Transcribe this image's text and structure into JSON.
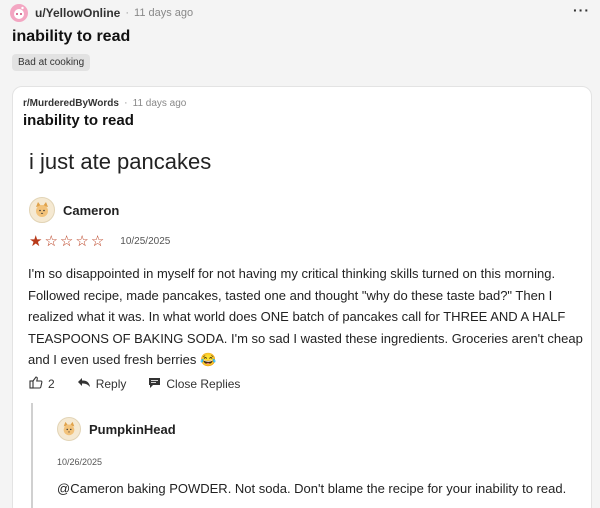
{
  "post": {
    "username": "u/YellowOnline",
    "separator": "·",
    "time": "11 days ago",
    "more": "···",
    "title": "inability to read",
    "flair": "Bad at cooking"
  },
  "crosspost": {
    "subreddit": "r/MurderedByWords",
    "separator": "·",
    "time": "11 days ago",
    "title": "inability to read"
  },
  "screenshot": {
    "title": "i just ate pancakes",
    "review": {
      "author": "Cameron",
      "rating": 1,
      "max_rating": 5,
      "date": "10/25/2025",
      "text": "I'm so disappointed in myself for not having my critical thinking skills turned on this morning. Followed recipe, made pancakes, tasted one and thought \"why do these taste bad?\" Then I realized what it was. In what world does ONE batch of pancakes call for THREE AND A HALF TEASPOONS OF BAKING SODA. I'm so sad I wasted these ingredients. Groceries aren't cheap and I even used fresh berries 😂",
      "likes": "2",
      "reply_label": "Reply",
      "close_replies_label": "Close Replies"
    },
    "reply": {
      "author": "PumpkinHead",
      "date": "10/26/2025",
      "text": "@Cameron baking POWDER. Not soda. Don't blame the recipe for your inability to read."
    }
  },
  "icons": {
    "avatar": "reddit-avatar-icon",
    "more": "more-options-icon",
    "cat": "cat-avatar-icon",
    "like": "thumbs-up-icon",
    "reply": "reply-arrow-icon",
    "close": "comment-bubble-icon",
    "star": "star-icon"
  },
  "colors": {
    "star": "#b83a1a",
    "avatar_bg": "#f3a6c2",
    "flair_bg": "#e2e2e2"
  }
}
